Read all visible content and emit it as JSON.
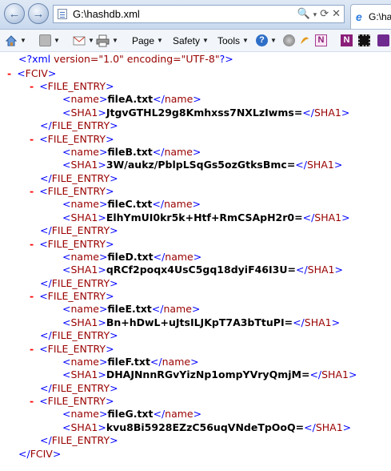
{
  "browser": {
    "address": "G:\\hashdb.xml",
    "address_actions": [
      "🔍",
      "▾",
      "⟳",
      "✕"
    ],
    "tab_title": "G:\\hashd",
    "command_bar": {
      "page_label": "Page",
      "safety_label": "Safety",
      "tools_label": "Tools"
    },
    "colors": {
      "chrome": "#c9d9ee",
      "tag": "#990000",
      "markup": "#0000ff",
      "collapse": "#ff0000"
    }
  },
  "xml": {
    "declaration": {
      "open": "<?xml",
      "version_attr": "version=\"1.0\"",
      "encoding_attr": "encoding=\"UTF-8\"",
      "close": "?>"
    },
    "collapse_glyph": "-",
    "root_tag": "FCIV",
    "entry_tag": "FILE_ENTRY",
    "name_tag": "name",
    "sha_tag": "SHA1",
    "entries": [
      {
        "name": "fileA.txt",
        "sha1": "JtgvGTHL29g8Kmhxss7NXLzIwms="
      },
      {
        "name": "fileB.txt",
        "sha1": "3W/aukz/PblpLSqGs5ozGtksBmc="
      },
      {
        "name": "fileC.txt",
        "sha1": "ElhYmUI0kr5k+Htf+RmCSApH2r0="
      },
      {
        "name": "fileD.txt",
        "sha1": "qRCf2poqx4UsC5gq18dyiF46I3U="
      },
      {
        "name": "fileE.txt",
        "sha1": "Bn+hDwL+uJtsILJKpT7A3bTtuPI="
      },
      {
        "name": "fileF.txt",
        "sha1": "DHAJNnnRGvYizNp1ompYVryQmjM="
      },
      {
        "name": "fileG.txt",
        "sha1": "kvu8Bi5928EZzC56uqVNdeTpOoQ="
      }
    ]
  }
}
